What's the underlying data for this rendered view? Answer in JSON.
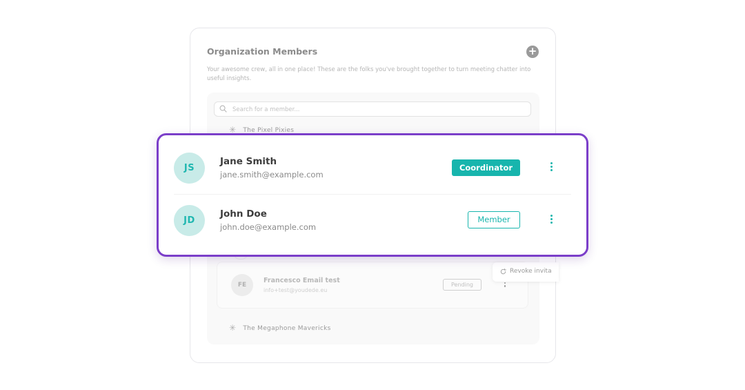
{
  "panel": {
    "title": "Organization Members",
    "add_icon": "plus-icon",
    "description": "Your awesome crew, all in one place! These are the folks you've brought together to turn meeting chatter into useful insights.",
    "search_placeholder": "Search for a member..."
  },
  "teams": [
    {
      "name": "The Pixel Pixies",
      "icon": "asterisk-icon"
    },
    {
      "name": "The Megaphone Mavericks",
      "icon": "asterisk-icon"
    }
  ],
  "members": [
    {
      "initials": "JS",
      "name": "Jane Smith",
      "email": "jane.smith@example.com",
      "role": "Coordinator"
    },
    {
      "initials": "JD",
      "name": "John Doe",
      "email": "john.doe@example.com",
      "role": "Member"
    }
  ],
  "pending_member": {
    "initials": "FE",
    "name": "Francesco Email test",
    "email": "info+test@youdede.eu",
    "status": "Pending"
  },
  "context_menu": {
    "revoke_label": "Revoke invita",
    "icon": "revoke-icon"
  },
  "colors": {
    "accent": "#17b5ad",
    "avatar_bg": "#c8ebe8",
    "highlight_border": "#7b3ec9"
  }
}
